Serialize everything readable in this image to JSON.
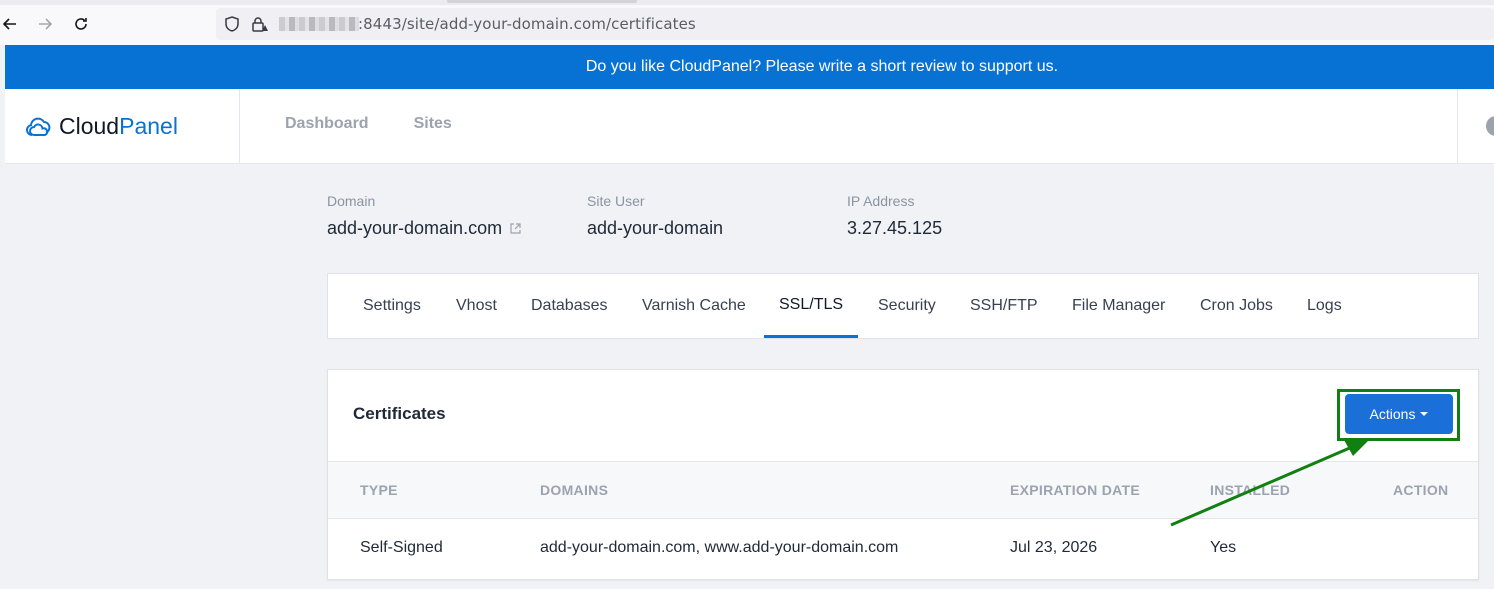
{
  "browser": {
    "url_visible": ":8443/site/add-your-domain.com/certificates"
  },
  "banner": {
    "text": "Do you like CloudPanel? Please write a short review to support us."
  },
  "brand": {
    "part1": "Cloud",
    "part2": "Panel",
    "accent_color": "#0a72d4"
  },
  "nav": {
    "items": [
      {
        "label": "Dashboard"
      },
      {
        "label": "Sites"
      }
    ]
  },
  "site_info": {
    "domain": {
      "label": "Domain",
      "value": "add-your-domain.com"
    },
    "site_user": {
      "label": "Site User",
      "value": "add-your-domain"
    },
    "ip": {
      "label": "IP Address",
      "value": "3.27.45.125"
    }
  },
  "tabs": [
    {
      "label": "Settings",
      "active": false
    },
    {
      "label": "Vhost",
      "active": false
    },
    {
      "label": "Databases",
      "active": false
    },
    {
      "label": "Varnish Cache",
      "active": false
    },
    {
      "label": "SSL/TLS",
      "active": true
    },
    {
      "label": "Security",
      "active": false
    },
    {
      "label": "SSH/FTP",
      "active": false
    },
    {
      "label": "File Manager",
      "active": false
    },
    {
      "label": "Cron Jobs",
      "active": false
    },
    {
      "label": "Logs",
      "active": false
    }
  ],
  "certificates": {
    "title": "Certificates",
    "actions_label": "Actions",
    "columns": [
      "TYPE",
      "DOMAINS",
      "EXPIRATION DATE",
      "INSTALLED",
      "ACTION"
    ],
    "rows": [
      {
        "type": "Self-Signed",
        "domains": "add-your-domain.com, www.add-your-domain.com",
        "expiration": "Jul 23, 2026",
        "installed": "Yes",
        "action": ""
      }
    ]
  },
  "annotation": {
    "color": "#118011"
  }
}
